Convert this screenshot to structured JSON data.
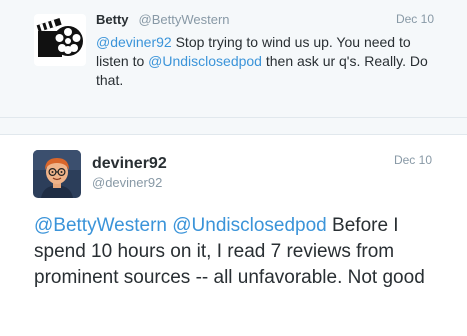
{
  "reply_tweet": {
    "name": "Betty",
    "handle": "@BettyWestern",
    "date": "Dec 10",
    "mention": "@deviner92",
    "text_part1": " Stop trying to wind us up. You need to listen to ",
    "mention2": "@Undisclosedpod",
    "text_part2": " then ask ur q's. Really. Do that.",
    "avatar_icon": "film-reel-clapperboard-icon"
  },
  "main_tweet": {
    "name": "deviner92",
    "handle": "@deviner92",
    "date": "Dec 10",
    "mention1": "@BettyWestern",
    "mention2": "@Undisclosedpod",
    "text": " Before I spend 10 hours on it, I read 7 reviews from prominent sources -- all unfavorable. Not good",
    "avatar_icon": "cartoon-person-avatar"
  },
  "colors": {
    "link": "#3b94d9",
    "muted": "#8899a6",
    "text": "#292f33",
    "reply_bg": "#f5f8fa"
  }
}
